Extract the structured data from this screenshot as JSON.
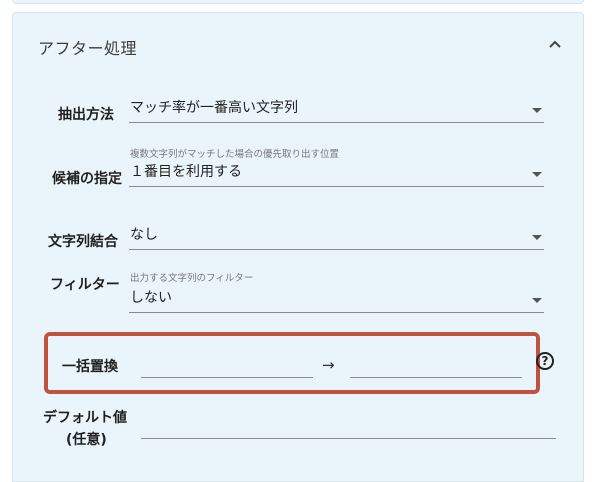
{
  "panel": {
    "title": "アフター処理",
    "collapse_icon": "chevron-up-icon"
  },
  "fields": {
    "extraction": {
      "label": "抽出方法",
      "value": "マッチ率が一番高い文字列"
    },
    "candidate": {
      "label": "候補の指定",
      "hint": "複数文字列がマッチした場合の優先取り出す位置",
      "value": "１番目を利用する"
    },
    "join": {
      "label": "文字列結合",
      "value": "なし"
    },
    "filter": {
      "label": "フィルター",
      "hint": "出力する文字列のフィルター",
      "value": "しない"
    },
    "replace": {
      "label": "一括置換",
      "from_value": "",
      "arrow": "→",
      "to_value": "",
      "help_icon": "question-circle-icon",
      "help_text": "?"
    },
    "default": {
      "label_line1": "デフォルト値",
      "label_line2": "(任意)",
      "value": ""
    }
  },
  "colors": {
    "panel_bg": "#e9f5fb",
    "highlight_border": "#c0533c"
  }
}
